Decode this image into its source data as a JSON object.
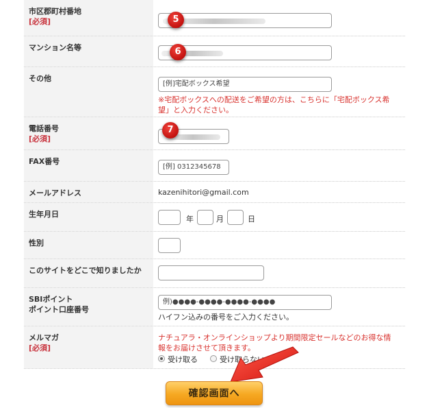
{
  "fields": {
    "address": {
      "label": "市区郡町村番地",
      "required": "[必須]",
      "badge": "5"
    },
    "building": {
      "label": "マンション名等",
      "badge": "6"
    },
    "other": {
      "label": "その他",
      "placeholder": "[例]宅配ボックス希望",
      "note": "※宅配ボックスへの配送をご希望の方は、こちらに「宅配ボックス希望」と入力ください。"
    },
    "phone": {
      "label": "電話番号",
      "required": "[必須]",
      "badge": "7"
    },
    "fax": {
      "label": "FAX番号",
      "placeholder": "[例] 0312345678"
    },
    "email": {
      "label": "メールアドレス",
      "value": "kazenihitori@gmail.com"
    },
    "birthday": {
      "label": "生年月日",
      "year_unit": "年",
      "month_unit": "月",
      "day_unit": "日"
    },
    "gender": {
      "label": "性別"
    },
    "referral": {
      "label": "このサイトをどこで知りましたか"
    },
    "sbi": {
      "label_line1": "SBIポイント",
      "label_line2": "ポイント口座番号",
      "placeholder": "例)●●●●-●●●●-●●●●-●●●●",
      "note": "ハイフン込みの番号をご入力ください。"
    },
    "newsletter": {
      "label": "メルマガ",
      "required": "[必須]",
      "note": "ナチュアラ・オンラインショップより期間限定セールなどのお得な情報をお届けさせて頂きます。",
      "options": [
        "受け取る",
        "受け取らない"
      ],
      "selected": "受け取る"
    }
  },
  "submit_label": "確認画面へ",
  "colors": {
    "required": "#c8323c",
    "note_red": "#d8322e",
    "button": "#f6a822",
    "badge": "#d9211b",
    "arrow": "#e02a20"
  }
}
